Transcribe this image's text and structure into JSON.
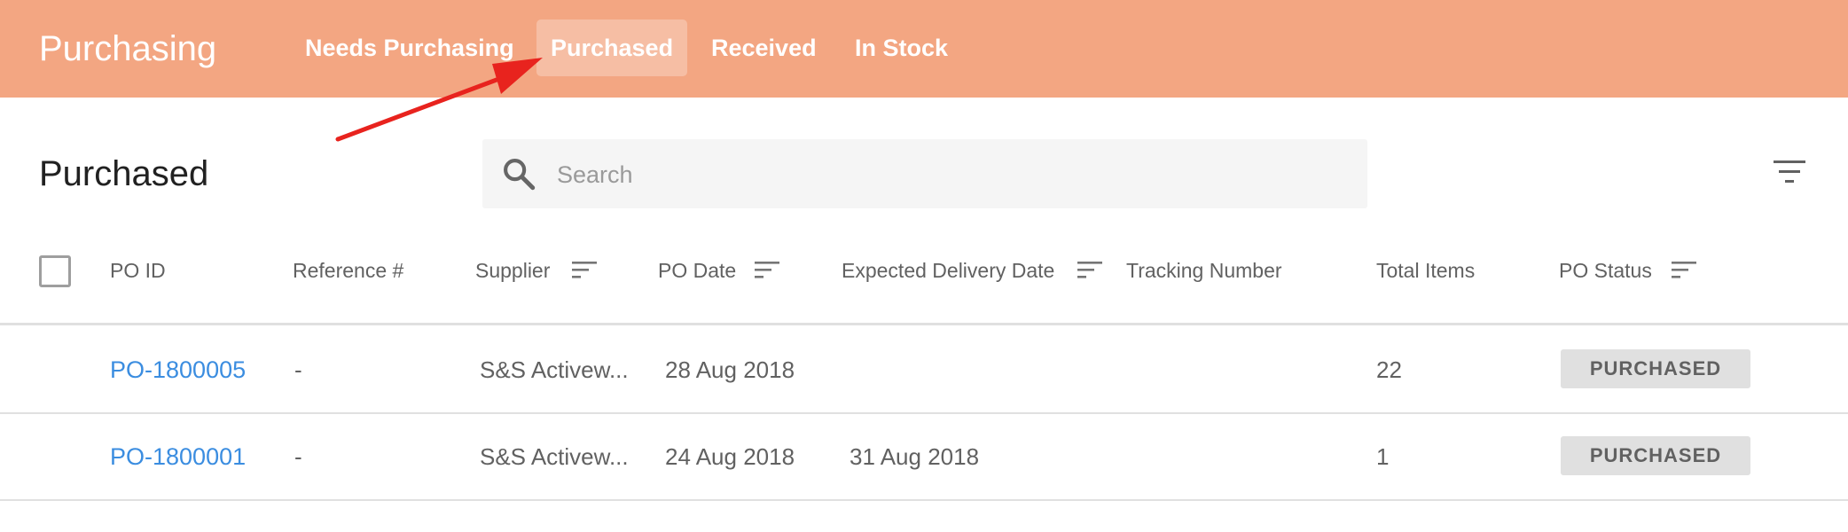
{
  "app": {
    "title": "Purchasing"
  },
  "tabs": [
    {
      "label": "Needs Purchasing",
      "active": false
    },
    {
      "label": "Purchased",
      "active": true
    },
    {
      "label": "Received",
      "active": false
    },
    {
      "label": "In Stock",
      "active": false
    }
  ],
  "page": {
    "title": "Purchased"
  },
  "search": {
    "placeholder": "Search",
    "value": ""
  },
  "table": {
    "columns": [
      "PO ID",
      "Reference #",
      "Supplier",
      "PO Date",
      "Expected Delivery Date",
      "Tracking Number",
      "Total Items",
      "PO Status"
    ],
    "rows": [
      {
        "po_id": "PO-1800005",
        "reference": "-",
        "supplier": "S&S Activew...",
        "po_date": "28 Aug 2018",
        "expected_delivery": "",
        "tracking": "",
        "total_items": "22",
        "status": "PURCHASED"
      },
      {
        "po_id": "PO-1800001",
        "reference": "-",
        "supplier": "S&S Activew...",
        "po_date": "24 Aug 2018",
        "expected_delivery": "31 Aug 2018",
        "tracking": "",
        "total_items": "1",
        "status": "PURCHASED"
      }
    ]
  },
  "colors": {
    "header_bg": "#f3a682",
    "link": "#3b8de0",
    "annotation_arrow": "#e8231e",
    "badge_bg": "#e0e0e0"
  },
  "icons": [
    "search-icon",
    "filter-icon",
    "sort-icon",
    "annotation-arrow"
  ]
}
